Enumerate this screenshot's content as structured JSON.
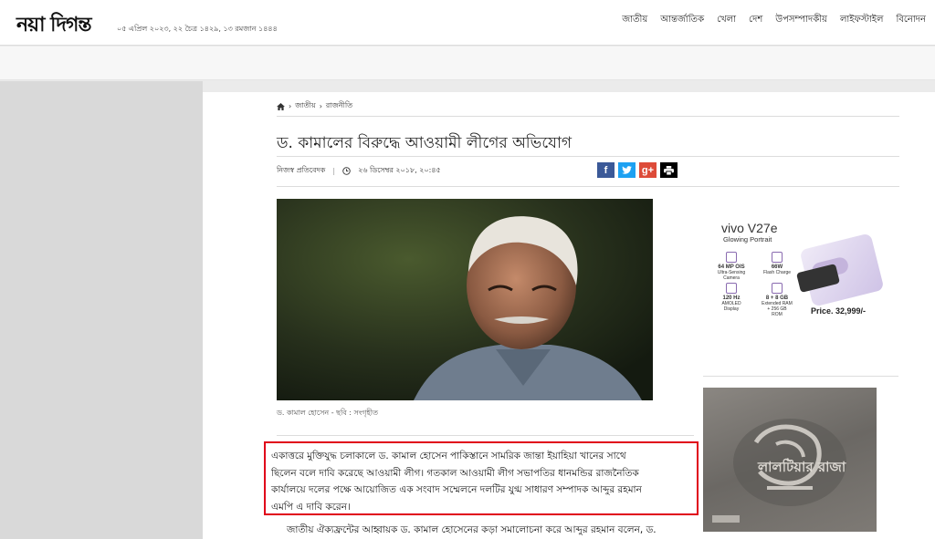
{
  "header": {
    "logo": "নয়া দিগন্ত",
    "dateline": "০৫ এপ্রিল ২০২৩, ২২ চৈত্র ১৪২৯, ১৩ রমজান ১৪৪৪",
    "nav": [
      "জাতীয়",
      "আন্তর্জাতিক",
      "খেলা",
      "দেশ",
      "উপসম্পাদকীয়",
      "লাইফস্টাইল",
      "বিনোদন"
    ]
  },
  "breadcrumb": {
    "home_icon": "home-icon",
    "items": [
      "জাতীয়",
      "রাজনীতি"
    ]
  },
  "article": {
    "title": "ড. কামালের বিরুদ্ধে আওয়ামী লীগের অভিযোগ",
    "author": "নিজস্ব প্রতিবেদক",
    "datetime": "২৬ ডিসেম্বর ২০১৮, ২০:৪৫",
    "caption": "ড. কামাল হোসেন - ছবি : সংগৃহীত",
    "lead_lines": [
      "একাত্তরে মুক্তিযুদ্ধ চলাকালে ড. কামাল হোসেন পাকিস্তানে সামরিক জান্তা ইয়াহিয়া খানের সাথে",
      "ছিলেন বলে দাবি করেছে আওয়ামী লীগ। গতকাল আওয়ামী লীগ সভাপতির ধানমন্ডির রাজনৈতিক",
      "কার্যালয়ে দলের পক্ষে আয়োজিত এক সংবাদ সম্মেলনে দলটির যুগ্ম সাধারণ সম্পাদক আব্দুর রহমান",
      "এমপি এ দাবি করেন।"
    ],
    "next_line": "জাতীয় ঐক্যফ্রন্টের আহ্বায়ক ড. কামাল হোসেনের কড়া সমালোচনা করে আব্দুর রহমান বলেন, ড."
  },
  "share": {
    "facebook": "f",
    "twitter": "t",
    "googleplus": "g+",
    "print": "print-icon"
  },
  "ad_vivo": {
    "brand": "vivo V27e",
    "tagline": "Glowing Portrait",
    "features": [
      {
        "value": "64 MP OIS",
        "desc": "Ultra-Sensing Camera"
      },
      {
        "value": "66W",
        "desc": "Flash Charge"
      },
      {
        "value": "120 Hz",
        "desc": "AMOLED Display"
      },
      {
        "value": "8 + 8 GB",
        "desc": "Extended RAM + 256 GB ROM"
      }
    ],
    "price": "Price. 32,999/-"
  },
  "ad_natok": {
    "title": "লালটিয়ার রাজা"
  },
  "colors": {
    "highlight_border": "#e0001a",
    "facebook": "#3b5998",
    "twitter": "#1da1f2",
    "googleplus": "#dd4b39"
  }
}
